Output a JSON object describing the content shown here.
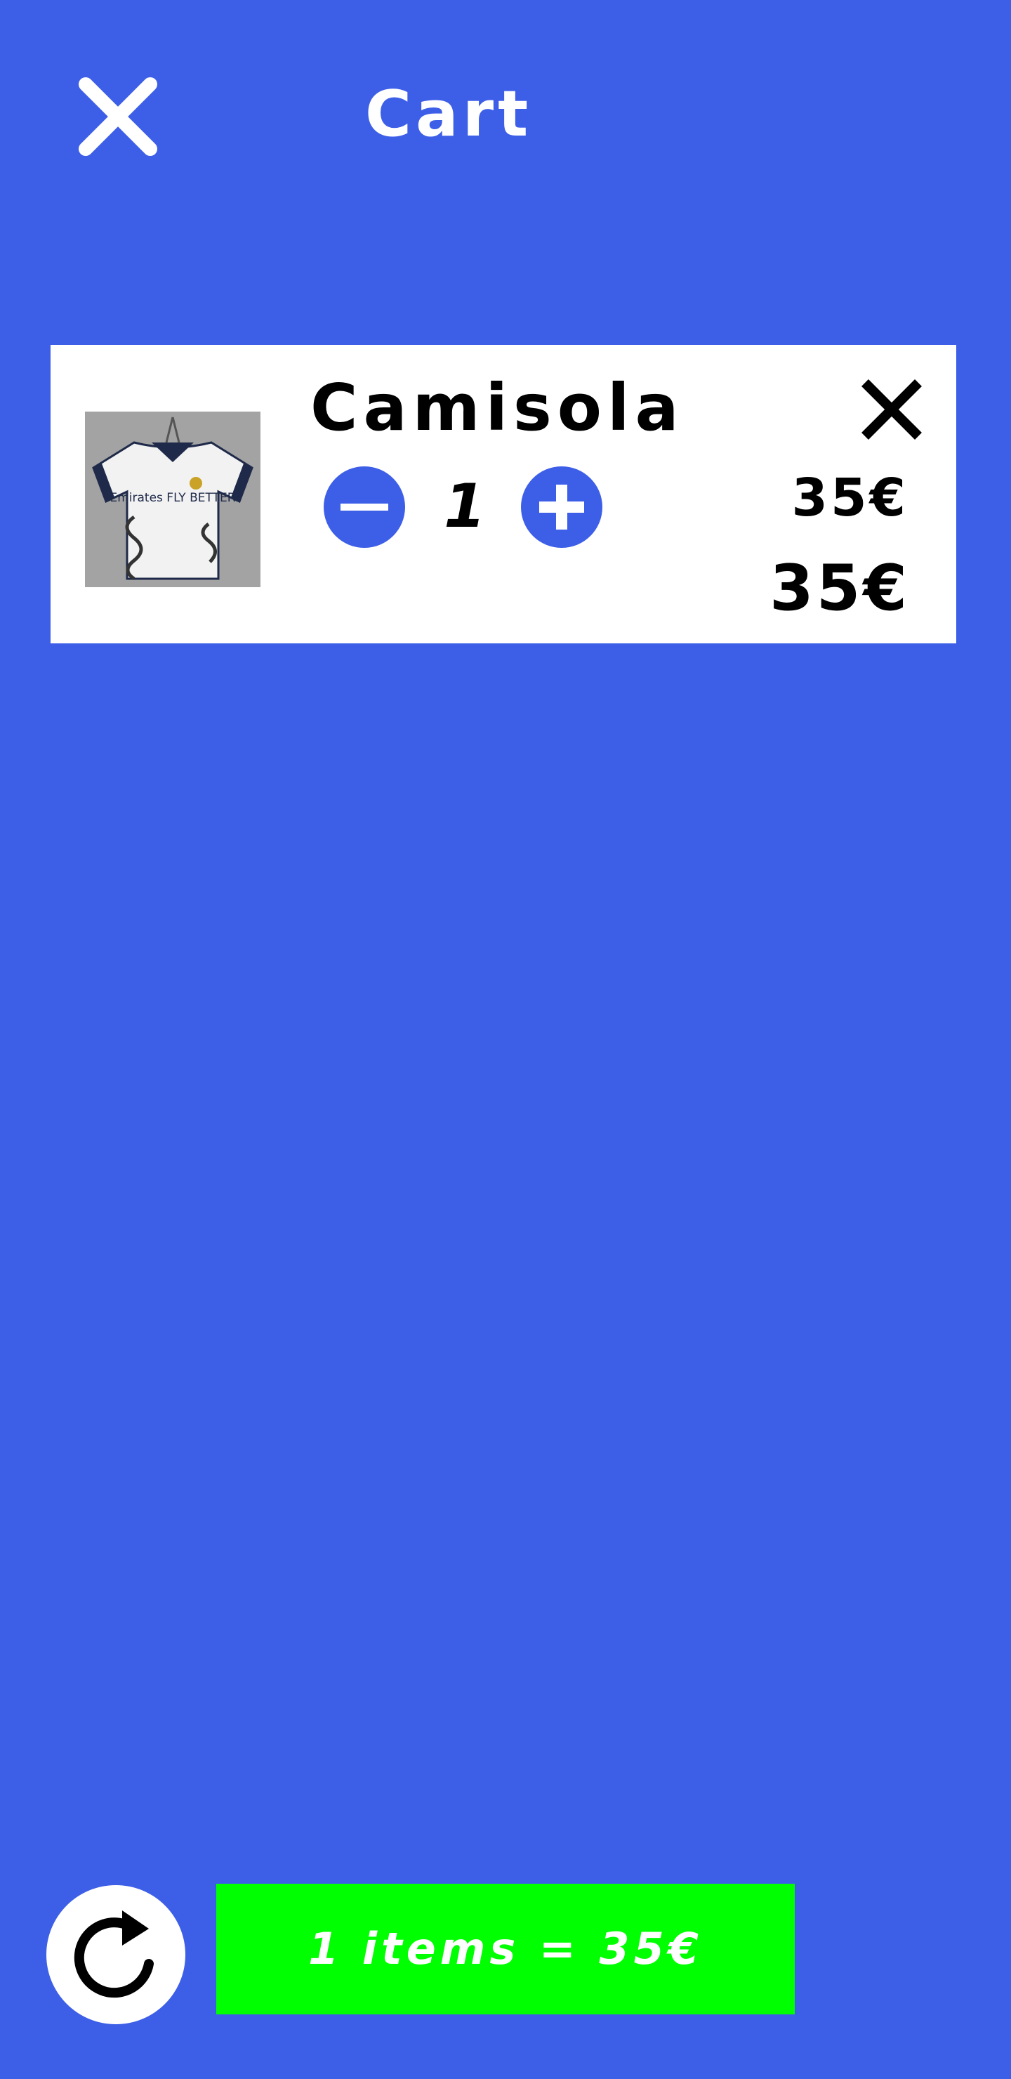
{
  "header": {
    "title": "Cart",
    "close_icon": "close-icon"
  },
  "cart": {
    "items": [
      {
        "name": "Camisola",
        "quantity": "1",
        "unit_price": "35€",
        "line_total": "35€",
        "image": "white-football-jersey-photo",
        "jersey_sponsor_text": "Emirates FLY BETTER",
        "remove_icon": "close-icon",
        "decrease_icon": "minus-icon",
        "increase_icon": "plus-icon"
      }
    ]
  },
  "footer": {
    "refresh_icon": "refresh-icon",
    "checkout_label": "1 items = 35€"
  },
  "colors": {
    "background": "#3D5FE8",
    "card": "#FFFFFF",
    "accent": "#3D5FE8",
    "checkout": "#00FF00",
    "text_dark": "#000000",
    "text_light": "#FFFFFF"
  }
}
